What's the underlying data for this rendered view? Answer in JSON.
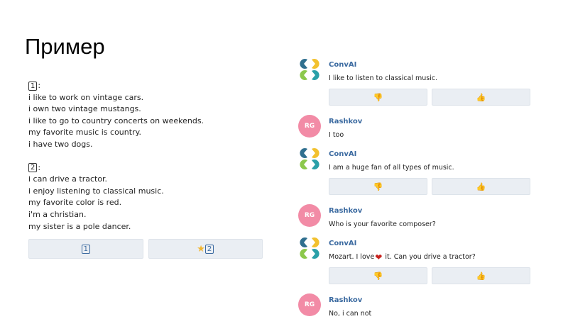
{
  "slide": {
    "title": "Пример"
  },
  "personas": [
    {
      "number": "1",
      "lines": [
        "i like to work on vintage cars.",
        "i own two vintage mustangs.",
        "i like to go to country concerts on weekends.",
        "my favorite music is country.",
        "i have two dogs."
      ]
    },
    {
      "number": "2",
      "lines": [
        "i can drive a tractor.",
        "i enjoy listening to classical music.",
        "my favorite color is red.",
        "i'm a christian.",
        "my sister is a pole dancer."
      ]
    }
  ],
  "choice_buttons": [
    {
      "number": "1"
    },
    {
      "number": "2",
      "icon": "star-icon"
    }
  ],
  "chat": {
    "messages": [
      {
        "sender": "ConvAI",
        "text": "I like to listen to classical music."
      },
      {
        "sender": "Rashkov",
        "initials": "RG",
        "text": "I too"
      },
      {
        "sender": "ConvAI",
        "text": "I am a huge fan of all types of music."
      },
      {
        "sender": "Rashkov",
        "initials": "RG",
        "text": "Who is your favorite composer?"
      },
      {
        "sender": "ConvAI",
        "text_before": "Mozart. I love",
        "text_after": " it. Can you drive a tractor?",
        "inline_icon": "heart-icon"
      },
      {
        "sender": "Rashkov",
        "initials": "RG",
        "text": "No, i can not"
      }
    ]
  },
  "colors": {
    "convai_name": "#3b6aa0",
    "user_avatar": "#f28ba6",
    "button_bg": "#eaeef3",
    "heart": "#c8231f",
    "star": "#f2b632"
  },
  "icons": {
    "bot_avatar": "convai-logo-icon",
    "thumbs_down": "thumbs-down-icon",
    "thumbs_up": "thumbs-up-icon"
  }
}
